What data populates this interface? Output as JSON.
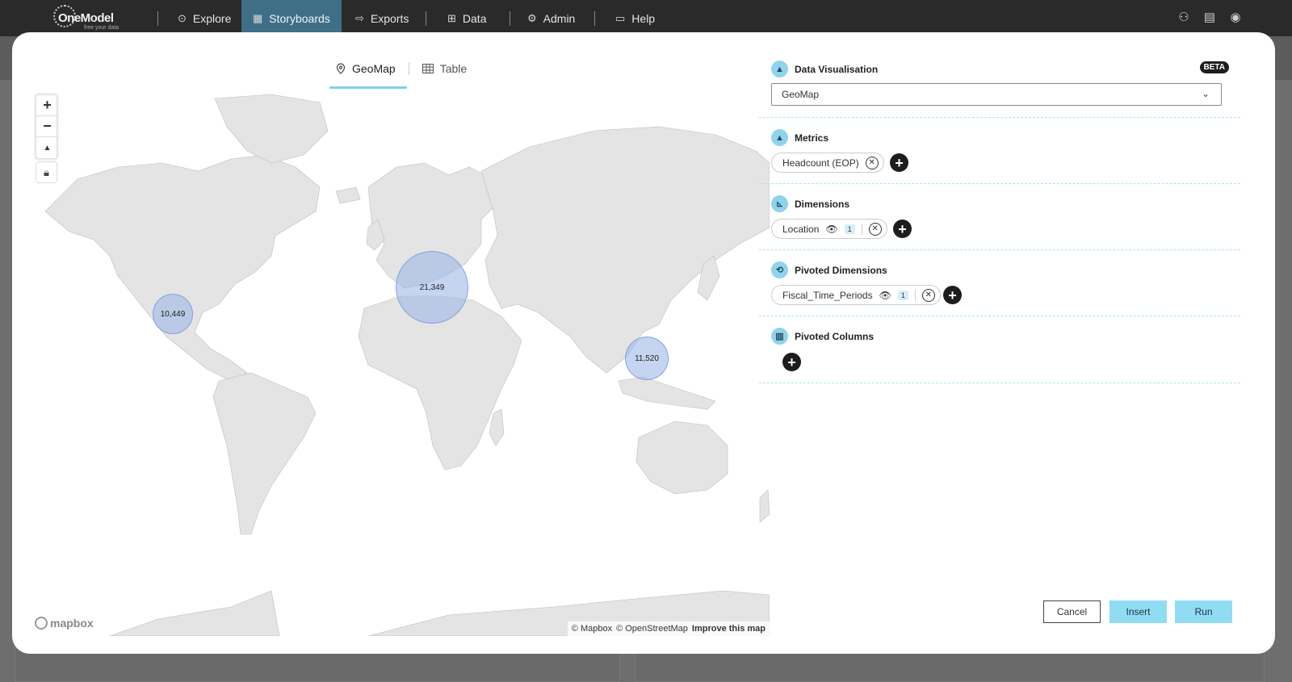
{
  "nav": {
    "logo_text": "OneModel",
    "logo_tagline": "free your data",
    "items": [
      {
        "label": "Explore",
        "icon": "compass-icon"
      },
      {
        "label": "Storyboards",
        "icon": "storyboard-icon"
      },
      {
        "label": "Exports",
        "icon": "export-icon"
      },
      {
        "label": "Data",
        "icon": "data-icon"
      },
      {
        "label": "Admin",
        "icon": "gear-icon"
      },
      {
        "label": "Help",
        "icon": "help-icon"
      }
    ],
    "active": "Storyboards",
    "right_icons": [
      "org-chart-icon",
      "calendar-icon",
      "user-icon"
    ]
  },
  "tabs": {
    "geomap": "GeoMap",
    "table": "Table",
    "active": "GeoMap"
  },
  "map": {
    "clusters": [
      {
        "label": "10,449",
        "region": "North America"
      },
      {
        "label": "21,349",
        "region": "Europe"
      },
      {
        "label": "11,520",
        "region": "East Asia"
      }
    ],
    "zoom_in": "+",
    "zoom_out": "−",
    "compass": "▲",
    "attribution": {
      "logo": "mapbox",
      "mapbox": "© Mapbox",
      "osm": "© OpenStreetMap",
      "improve": "Improve this map"
    }
  },
  "panel": {
    "data_vis": {
      "title": "Data Visualisation",
      "beta": "BETA",
      "selected": "GeoMap"
    },
    "metrics": {
      "title": "Metrics",
      "chips": [
        {
          "label": "Headcount (EOP)"
        }
      ]
    },
    "dimensions": {
      "title": "Dimensions",
      "chips": [
        {
          "label": "Location",
          "count": "1"
        }
      ]
    },
    "pivoted_dimensions": {
      "title": "Pivoted Dimensions",
      "chips": [
        {
          "label": "Fiscal_Time_Periods",
          "count": "1"
        }
      ]
    },
    "pivoted_columns": {
      "title": "Pivoted Columns"
    }
  },
  "footer": {
    "cancel": "Cancel",
    "insert": "Insert",
    "run": "Run"
  },
  "colors": {
    "accent": "#8fdcf3",
    "nav_bg": "#2a2a2a",
    "nav_active": "#3f6f86",
    "cluster_fill": "#9eb7e6"
  }
}
